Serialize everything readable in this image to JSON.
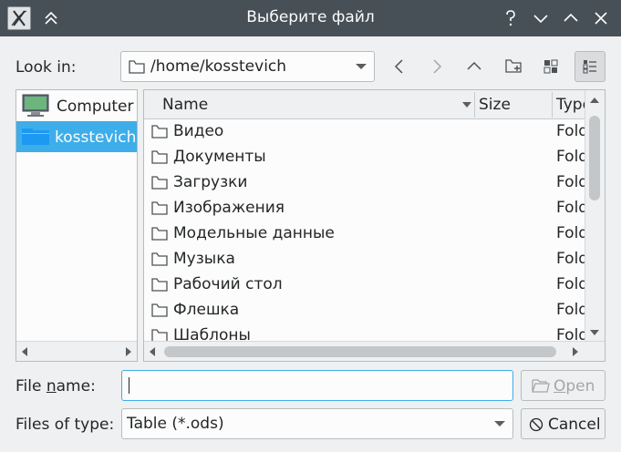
{
  "window": {
    "title": "Выберите файл",
    "buttons": [
      "help-icon",
      "minimize-icon",
      "maximize-icon",
      "close-icon"
    ]
  },
  "look_in": {
    "label": "Look in:",
    "path": "/home/kosstevich"
  },
  "toolbar": {
    "icons": [
      "back-icon",
      "forward-icon",
      "parent-dir-icon",
      "new-folder-icon",
      "list-view-icon",
      "detail-view-icon"
    ]
  },
  "sidebar": {
    "items": [
      {
        "label": "Computer",
        "icon": "computer-icon",
        "selected": false
      },
      {
        "label": "kosstevich",
        "icon": "home-folder-icon",
        "selected": true
      }
    ]
  },
  "filelist": {
    "columns": {
      "name": "Name",
      "size": "Size",
      "type": "Type"
    },
    "rows": [
      {
        "name": "Видео",
        "type": "Folder"
      },
      {
        "name": "Документы",
        "type": "Folder"
      },
      {
        "name": "Загрузки",
        "type": "Folder"
      },
      {
        "name": "Изображения",
        "type": "Folder"
      },
      {
        "name": "Модельные данные",
        "type": "Folder"
      },
      {
        "name": "Музыка",
        "type": "Folder"
      },
      {
        "name": "Рабочий стол",
        "type": "Folder"
      },
      {
        "name": "Флешка",
        "type": "Folder"
      },
      {
        "name": "Шаблоны",
        "type": "Folder"
      }
    ]
  },
  "file_name": {
    "label_prefix": "File ",
    "label_accel": "n",
    "label_suffix": "ame:",
    "value": ""
  },
  "file_type": {
    "label": "Files of type:",
    "value": "Table (*.ods)"
  },
  "buttons": {
    "open_accel": "O",
    "open_rest": "pen",
    "cancel": "Cancel"
  }
}
